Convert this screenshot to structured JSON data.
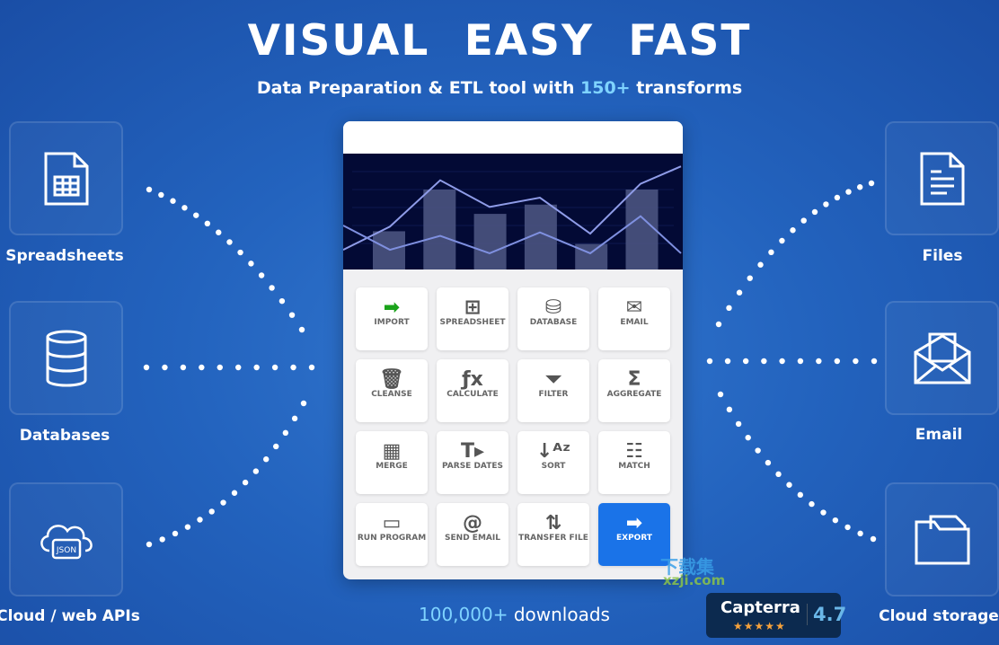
{
  "header": {
    "title": "VISUAL EASY FAST",
    "subtitle_pre": "Data Preparation & ETL tool with ",
    "subtitle_hl": "150+",
    "subtitle_post": " transforms"
  },
  "sources": [
    {
      "label": "Spreadsheets",
      "icon": "spreadsheet-icon"
    },
    {
      "label": "Databases",
      "icon": "database-icon"
    },
    {
      "label": "Cloud / web APIs",
      "icon": "cloud-json-icon",
      "badge": "JSON"
    }
  ],
  "destinations": [
    {
      "label": "Files",
      "icon": "file-icon"
    },
    {
      "label": "Email",
      "icon": "email-icon"
    },
    {
      "label": "Cloud storage",
      "icon": "folder-icon"
    }
  ],
  "hero_chart": {
    "bars": [
      33,
      69,
      48,
      56,
      22,
      69
    ],
    "line_a": [
      17,
      37,
      77,
      54,
      62,
      31,
      74,
      89
    ],
    "line_b": [
      38,
      17,
      29,
      14,
      32,
      14,
      46,
      14
    ]
  },
  "tiles": [
    {
      "label": "IMPORT",
      "icon": "➡"
    },
    {
      "label": "SPREADSHEET",
      "icon": "⊞"
    },
    {
      "label": "DATABASE",
      "icon": "⛁"
    },
    {
      "label": "EMAIL",
      "icon": "✉"
    },
    {
      "label": "CLEANSE",
      "icon": "🗑"
    },
    {
      "label": "CALCULATE",
      "icon": "ƒx"
    },
    {
      "label": "FILTER",
      "icon": "⏷"
    },
    {
      "label": "AGGREGATE",
      "icon": "Σ"
    },
    {
      "label": "MERGE",
      "icon": "▦"
    },
    {
      "label": "PARSE DATES",
      "icon": "T▸"
    },
    {
      "label": "SORT",
      "icon": "↓ᴬᶻ"
    },
    {
      "label": "MATCH",
      "icon": "☷"
    },
    {
      "label": "RUN PROGRAM",
      "icon": "▭"
    },
    {
      "label": "SEND EMAIL",
      "icon": "@"
    },
    {
      "label": "TRANSFER FILE",
      "icon": "⇅"
    },
    {
      "label": "EXPORT",
      "icon": "➡"
    }
  ],
  "footer": {
    "downloads_hl": "100,000+",
    "downloads_post": " downloads"
  },
  "capterra": {
    "name": "Capterra",
    "stars": "★★★★★",
    "rating": "4.7"
  },
  "watermark": {
    "cn": "下载集",
    "url": "xzji.com"
  },
  "colors": {
    "accent": "#7fd3ff",
    "export_tile": "#1a73e8",
    "import_arrow": "#1aa31a"
  }
}
